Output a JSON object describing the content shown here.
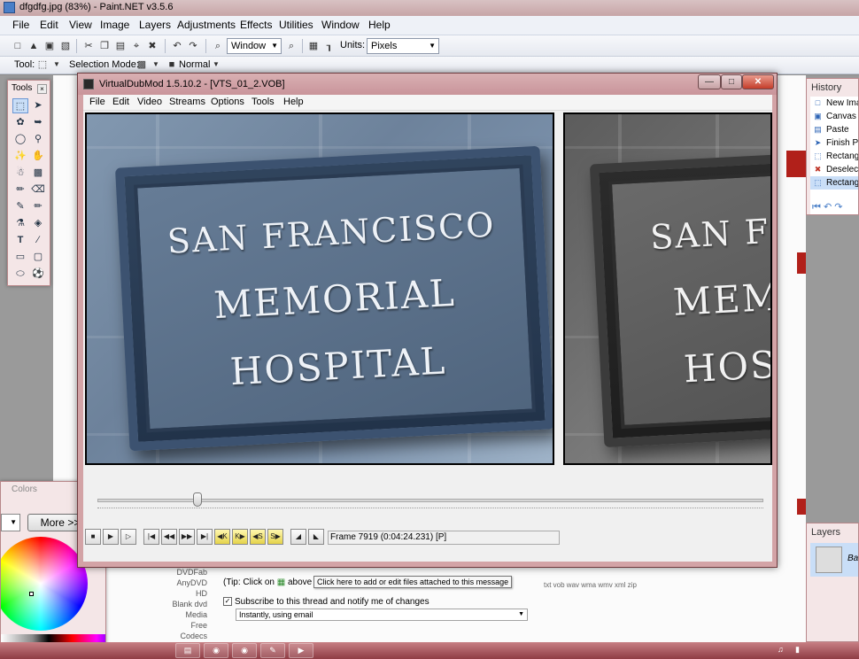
{
  "paintnet": {
    "title": "dfgdfg.jpg (83%) - Paint.NET v3.5.6",
    "menu": [
      "File",
      "Edit",
      "View",
      "Image",
      "Layers",
      "Adjustments",
      "Effects",
      "Utilities",
      "Window",
      "Help"
    ],
    "toolbar": {
      "zoom_combo": "Window",
      "units_label": "Units:",
      "units_combo": "Pixels",
      "tool_label": "Tool:",
      "selection_mode_label": "Selection Mode:",
      "blend_mode": "Normal"
    }
  },
  "tools_window": {
    "title": "Tools",
    "tools": [
      "rectangle-select",
      "move-selection",
      "lasso-select",
      "move-selected",
      "ellipse-select",
      "zoom",
      "magic-wand",
      "pan",
      "paint-bucket",
      "gradient",
      "paintbrush",
      "eraser",
      "pencil",
      "color-picker",
      "clone-stamp",
      "recolor",
      "text",
      "line-curve",
      "rectangle",
      "rounded-rectangle",
      "ellipse",
      "freeform-shape"
    ]
  },
  "history_window": {
    "title": "History",
    "items": [
      {
        "label": "New Imag",
        "icon": "new-image-icon"
      },
      {
        "label": "Canvas S",
        "icon": "canvas-size-icon"
      },
      {
        "label": "Paste",
        "icon": "paste-icon"
      },
      {
        "label": "Finish Pix",
        "icon": "move-pixels-icon"
      },
      {
        "label": "Rectangl",
        "icon": "rectangle-select-icon"
      },
      {
        "label": "Deselect",
        "icon": "deselect-icon"
      },
      {
        "label": "Rectangl",
        "icon": "rectangle-select-icon"
      }
    ]
  },
  "layers_window": {
    "title": "Layers",
    "layer_name": "Ba"
  },
  "colors_window": {
    "title": "Colors",
    "more_button": "More >>"
  },
  "vdm": {
    "title": "VirtualDubMod 1.5.10.2 - [VTS_01_2.VOB]",
    "menu": [
      "File",
      "Edit",
      "Video",
      "Streams",
      "Options",
      "Tools",
      "Help"
    ],
    "input_sign": [
      "SAN FRANCISCO",
      "MEMORIAL",
      "HOSPITAL"
    ],
    "output_sign": [
      "SAN FR",
      "MEM",
      "HOS"
    ],
    "frame_readout": "Frame 7919 (0:04:24.231) [P]",
    "seek_position": 0.15
  },
  "web": {
    "sidebar": [
      "DVDFab",
      "AnyDVD HD",
      "Blank dvd",
      "Media",
      "Free Codecs"
    ],
    "tip": "(Tip: Click on",
    "tip_tail": "above to",
    "tooltip": "Click here to add or edit files attached to this message",
    "extensions": "txt vob wav wma wmv xml zip",
    "subscribe": "Subscribe to this thread and notify me of changes",
    "notify_option": "Instantly, using email"
  },
  "colors": {
    "titlebar_pink": "#c9949a",
    "accent_red": "#b1201a"
  }
}
